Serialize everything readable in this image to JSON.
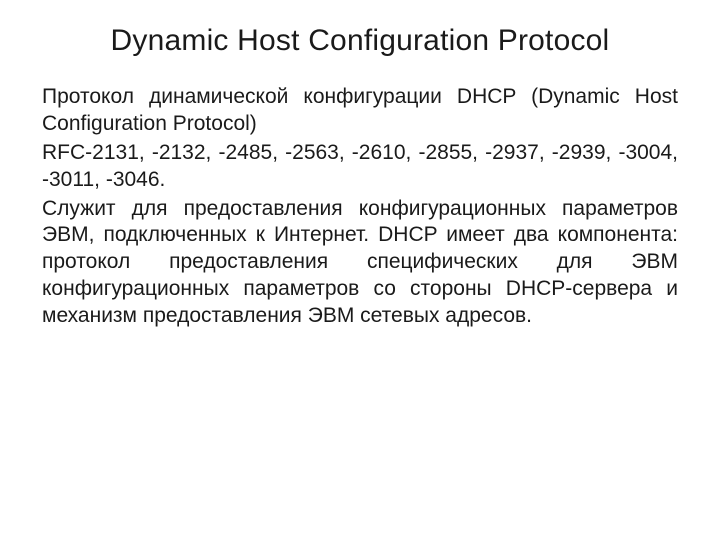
{
  "title": "Dynamic Host Configuration Protocol",
  "paragraphs": [
    "Протокол динамической конфигурации DHCP (Dynamic Host Configuration Protocol)",
    "RFC-2131, -2132, -2485, -2563, -2610, -2855, -2937, -2939, -3004, -3011, -3046.",
    "Служит для предоставления конфигурационных параметров ЭВМ, подключенных к Интернет. DHCP имеет два компонента: протокол предоставления специфических для ЭВМ конфигурационных параметров со стороны DHCP-сервера и механизм предоставления ЭВМ сетевых адресов."
  ]
}
